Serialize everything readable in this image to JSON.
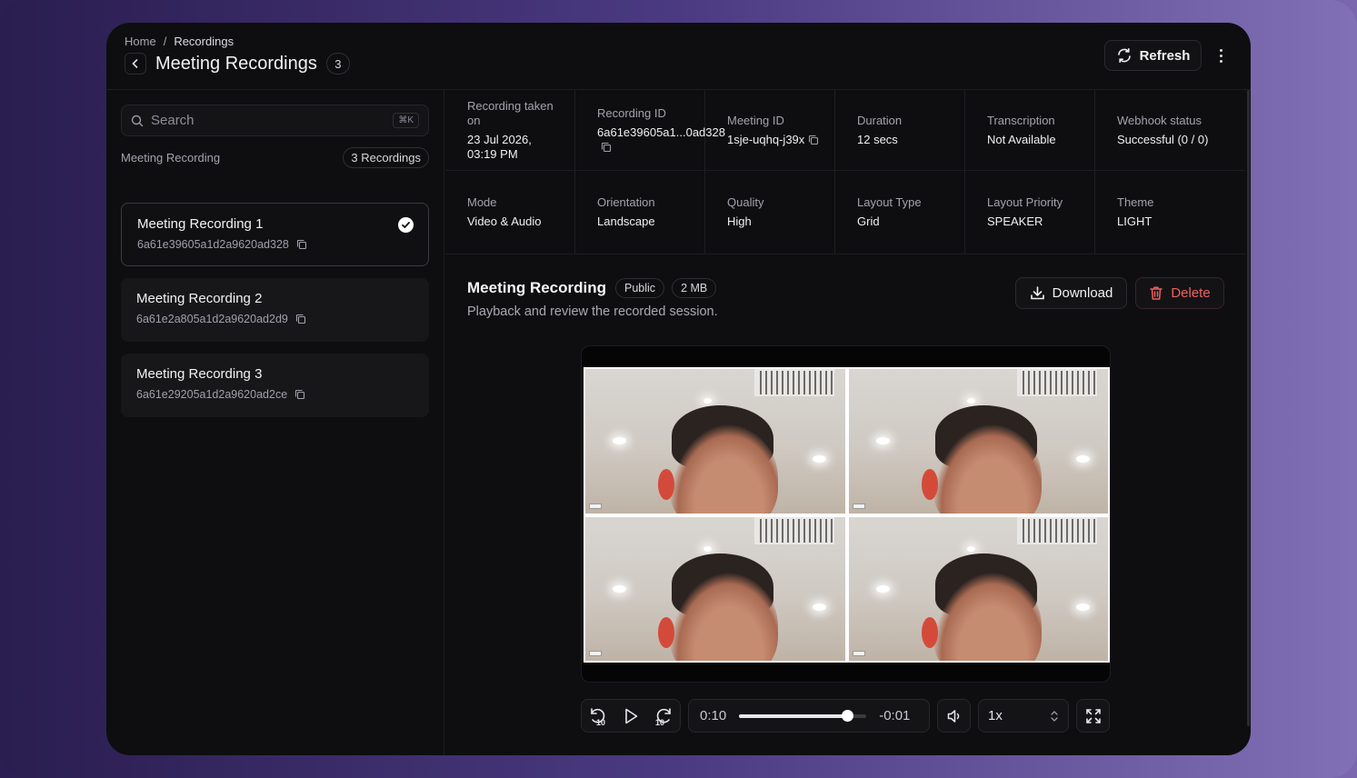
{
  "breadcrumb": {
    "home": "Home",
    "separator": "/",
    "current": "Recordings"
  },
  "header": {
    "title": "Meeting Recordings",
    "count": "3",
    "refresh_label": "Refresh"
  },
  "search": {
    "placeholder": "Search",
    "shortcut": "⌘K"
  },
  "list": {
    "label": "Meeting Recording",
    "count_label": "3 Recordings",
    "items": [
      {
        "name": "Meeting Recording 1",
        "id": "6a61e39605a1d2a9620ad328",
        "selected": true
      },
      {
        "name": "Meeting Recording 2",
        "id": "6a61e2a805a1d2a9620ad2d9",
        "selected": false
      },
      {
        "name": "Meeting Recording 3",
        "id": "6a61e29205a1d2a9620ad2ce",
        "selected": false
      }
    ]
  },
  "details": {
    "row1": [
      {
        "key": "Recording taken on",
        "value": "23 Jul 2026, 03:19 PM"
      },
      {
        "key": "Recording ID",
        "value": "6a61e39605a1...0ad328"
      },
      {
        "key": "Meeting ID",
        "value": "1sje-uqhq-j39x"
      },
      {
        "key": "Duration",
        "value": "12 secs"
      },
      {
        "key": "Transcription",
        "value": "Not Available"
      },
      {
        "key": "Webhook status",
        "value": "Successful (0 / 0)"
      }
    ],
    "row2": [
      {
        "key": "Mode",
        "value": "Video & Audio"
      },
      {
        "key": "Orientation",
        "value": "Landscape"
      },
      {
        "key": "Quality",
        "value": "High"
      },
      {
        "key": "Layout Type",
        "value": "Grid"
      },
      {
        "key": "Layout Priority",
        "value": "SPEAKER"
      },
      {
        "key": "Theme",
        "value": "LIGHT"
      }
    ]
  },
  "recording": {
    "title": "Meeting Recording",
    "visibility": "Public",
    "size": "2 MB",
    "description": "Playback and review the recorded session.",
    "download_label": "Download",
    "delete_label": "Delete"
  },
  "player": {
    "skip_back": "10",
    "skip_forward": "10",
    "current_time": "0:10",
    "remaining_time": "-0:01",
    "progress": 0.85,
    "speed": "1x"
  },
  "colors": {
    "danger": "#f0605e",
    "background": "#0e0e10",
    "accent_gradient_end": "#8270b6"
  }
}
